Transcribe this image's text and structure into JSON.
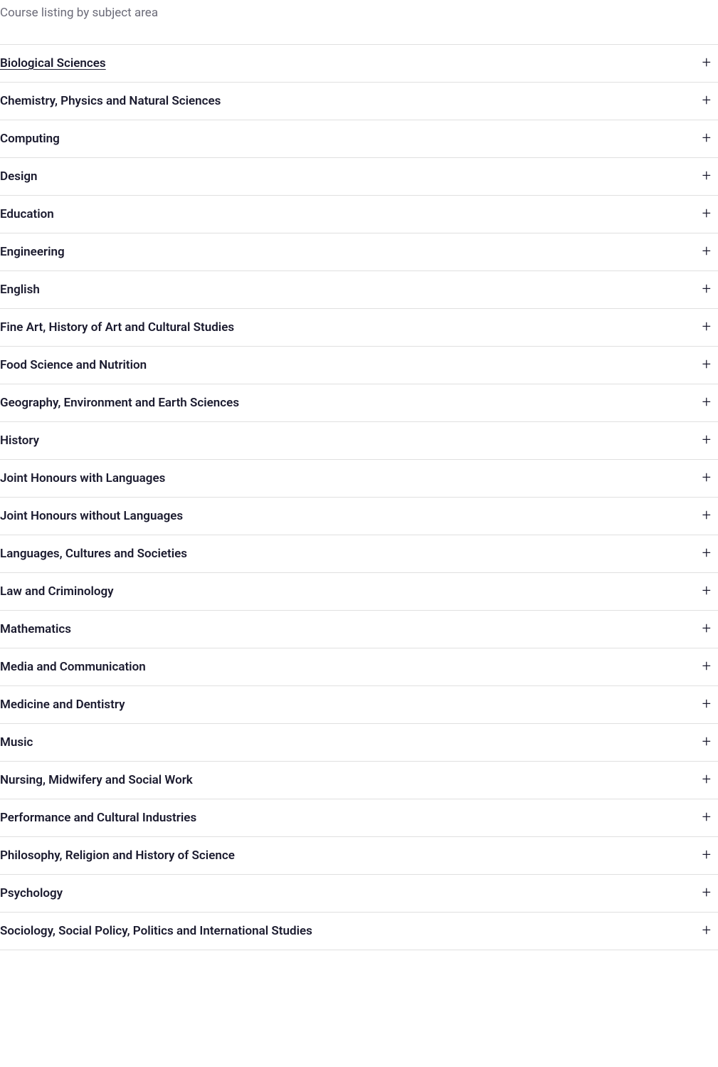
{
  "title": "Course listing by subject area",
  "subjects": [
    {
      "label": "Biological Sciences",
      "hovered": true
    },
    {
      "label": "Chemistry, Physics and Natural Sciences",
      "hovered": false
    },
    {
      "label": "Computing",
      "hovered": false
    },
    {
      "label": "Design",
      "hovered": false
    },
    {
      "label": "Education",
      "hovered": false
    },
    {
      "label": "Engineering",
      "hovered": false
    },
    {
      "label": "English",
      "hovered": false
    },
    {
      "label": "Fine Art, History of Art and Cultural Studies",
      "hovered": false
    },
    {
      "label": "Food Science and Nutrition",
      "hovered": false
    },
    {
      "label": "Geography, Environment and Earth Sciences",
      "hovered": false
    },
    {
      "label": "History",
      "hovered": false
    },
    {
      "label": "Joint Honours with Languages",
      "hovered": false
    },
    {
      "label": "Joint Honours without Languages",
      "hovered": false
    },
    {
      "label": "Languages, Cultures and Societies",
      "hovered": false
    },
    {
      "label": "Law and Criminology",
      "hovered": false
    },
    {
      "label": "Mathematics",
      "hovered": false
    },
    {
      "label": "Media and Communication",
      "hovered": false
    },
    {
      "label": "Medicine and Dentistry",
      "hovered": false
    },
    {
      "label": "Music",
      "hovered": false
    },
    {
      "label": "Nursing, Midwifery and Social Work",
      "hovered": false
    },
    {
      "label": "Performance and Cultural Industries",
      "hovered": false
    },
    {
      "label": "Philosophy, Religion and History of Science",
      "hovered": false
    },
    {
      "label": "Psychology",
      "hovered": false
    },
    {
      "label": "Sociology, Social Policy, Politics and International Studies",
      "hovered": false
    }
  ],
  "icons": {
    "plus": "+"
  }
}
